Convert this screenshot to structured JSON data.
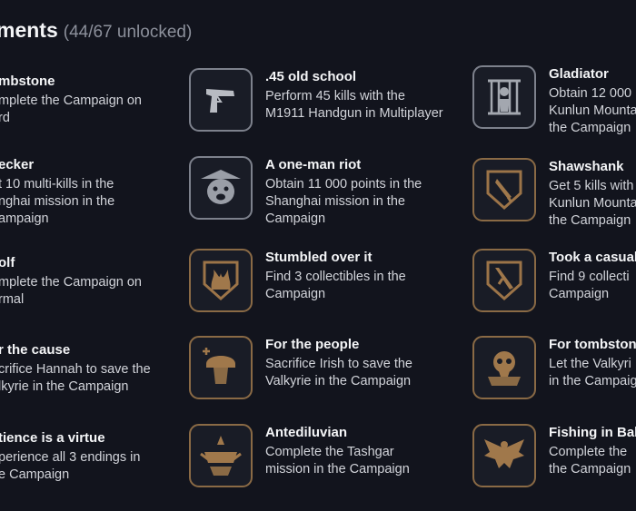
{
  "header": {
    "title": "ments",
    "count": "(44/67 unlocked)"
  },
  "columns": [
    [
      {
        "name": "mbstone",
        "lines": [
          "mplete the Campaign on",
          "rd"
        ]
      },
      {
        "name": "ecker",
        "lines": [
          "t 10 multi-kills in the",
          "nghai mission in the",
          "ampaign"
        ]
      },
      {
        "name": "olf",
        "lines": [
          "mplete the Campaign on",
          "rmal"
        ]
      },
      {
        "name": "r the cause",
        "lines": [
          "crifice Hannah to save the",
          "lkyrie in the Campaign"
        ]
      },
      {
        "name": "tience is a virtue",
        "lines": [
          "perience all 3 endings in",
          "e Campaign"
        ]
      }
    ],
    [
      {
        "name": ".45 old school",
        "lines": [
          "Perform 45 kills with the",
          "M1911 Handgun in Multiplayer"
        ],
        "icon": "handgun-icon",
        "gold": false
      },
      {
        "name": "A one-man riot",
        "lines": [
          "Obtain 11 000 points in the",
          "Shanghai mission in the",
          "Campaign"
        ],
        "icon": "bear-mask-icon",
        "gold": false
      },
      {
        "name": "Stumbled over it",
        "lines": [
          "Find 3 collectibles in the",
          "Campaign"
        ],
        "icon": "flame-shield-icon",
        "gold": true
      },
      {
        "name": "For the people",
        "lines": [
          "Sacrifice Irish to save the",
          "Valkyrie in the Campaign"
        ],
        "icon": "helmet-cross-icon",
        "gold": true
      },
      {
        "name": "Antediluvian",
        "lines": [
          "Complete the Tashgar",
          "mission in the Campaign"
        ],
        "icon": "ship-emblem-icon",
        "gold": true
      }
    ],
    [
      {
        "name": "Gladiator",
        "lines": [
          "Obtain 12 000",
          "Kunlun Mounta",
          "the Campaign"
        ],
        "icon": "cage-icon",
        "gold": false
      },
      {
        "name": "Shawshank",
        "lines": [
          "Get 5 kills with",
          "Kunlun Mounta",
          "the Campaign"
        ],
        "icon": "knife-shield-icon",
        "gold": true
      },
      {
        "name": "Took a casual",
        "lines": [
          "Find 9 collecti",
          "Campaign"
        ],
        "icon": "rifle-shield-icon",
        "gold": true
      },
      {
        "name": "For tombston",
        "lines": [
          "Let the Valkyri",
          "in the Campaig"
        ],
        "icon": "skull-icon",
        "gold": true
      },
      {
        "name": "Fishing in Bak",
        "lines": [
          "Complete the",
          "the Campaign"
        ],
        "icon": "eagle-icon",
        "gold": true
      }
    ]
  ]
}
